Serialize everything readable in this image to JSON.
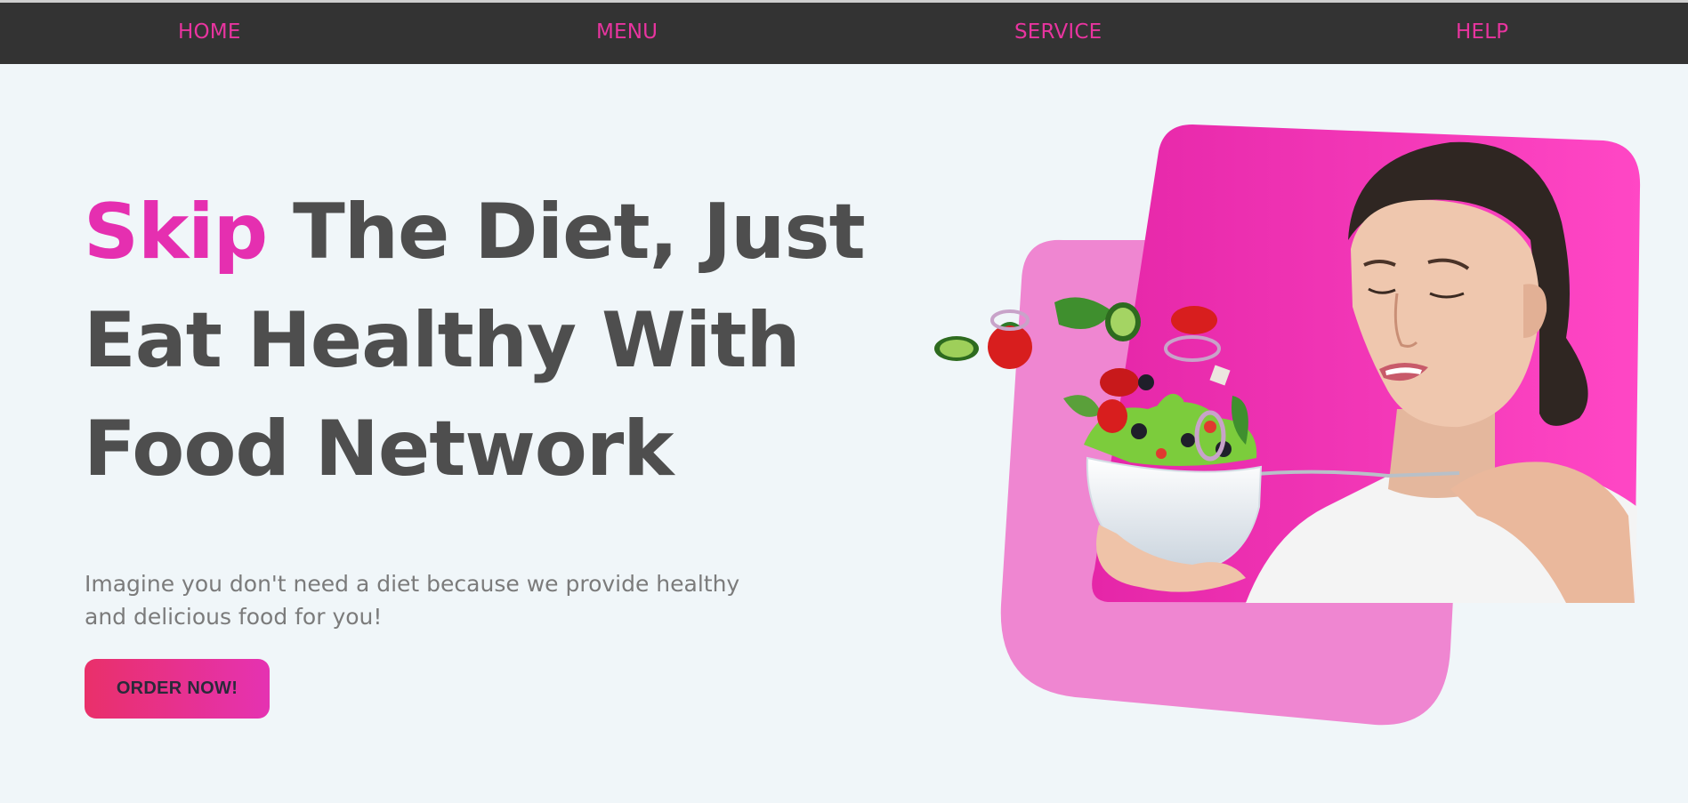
{
  "nav": {
    "items": [
      {
        "label": "HOME"
      },
      {
        "label": "MENU"
      },
      {
        "label": "SERVICE"
      },
      {
        "label": "HELP"
      }
    ]
  },
  "hero": {
    "title_accent": "Skip",
    "title_rest_line1": " The Diet, Just",
    "title_line2": "Eat Healthy With",
    "title_line3": "Food Network",
    "subtitle": "Imagine you don't need a diet because we provide healthy and delicious food for you!",
    "cta_label": "ORDER NOW!"
  },
  "image": {
    "icon": "woman-eating-salad-illustration"
  },
  "colors": {
    "nav_bg": "#333333",
    "accent_pink": "#e52fb0",
    "heading": "#4e4e4e",
    "body_bg": "#f0f6f9",
    "button_start": "#e9306a",
    "button_end": "#e532b2"
  }
}
